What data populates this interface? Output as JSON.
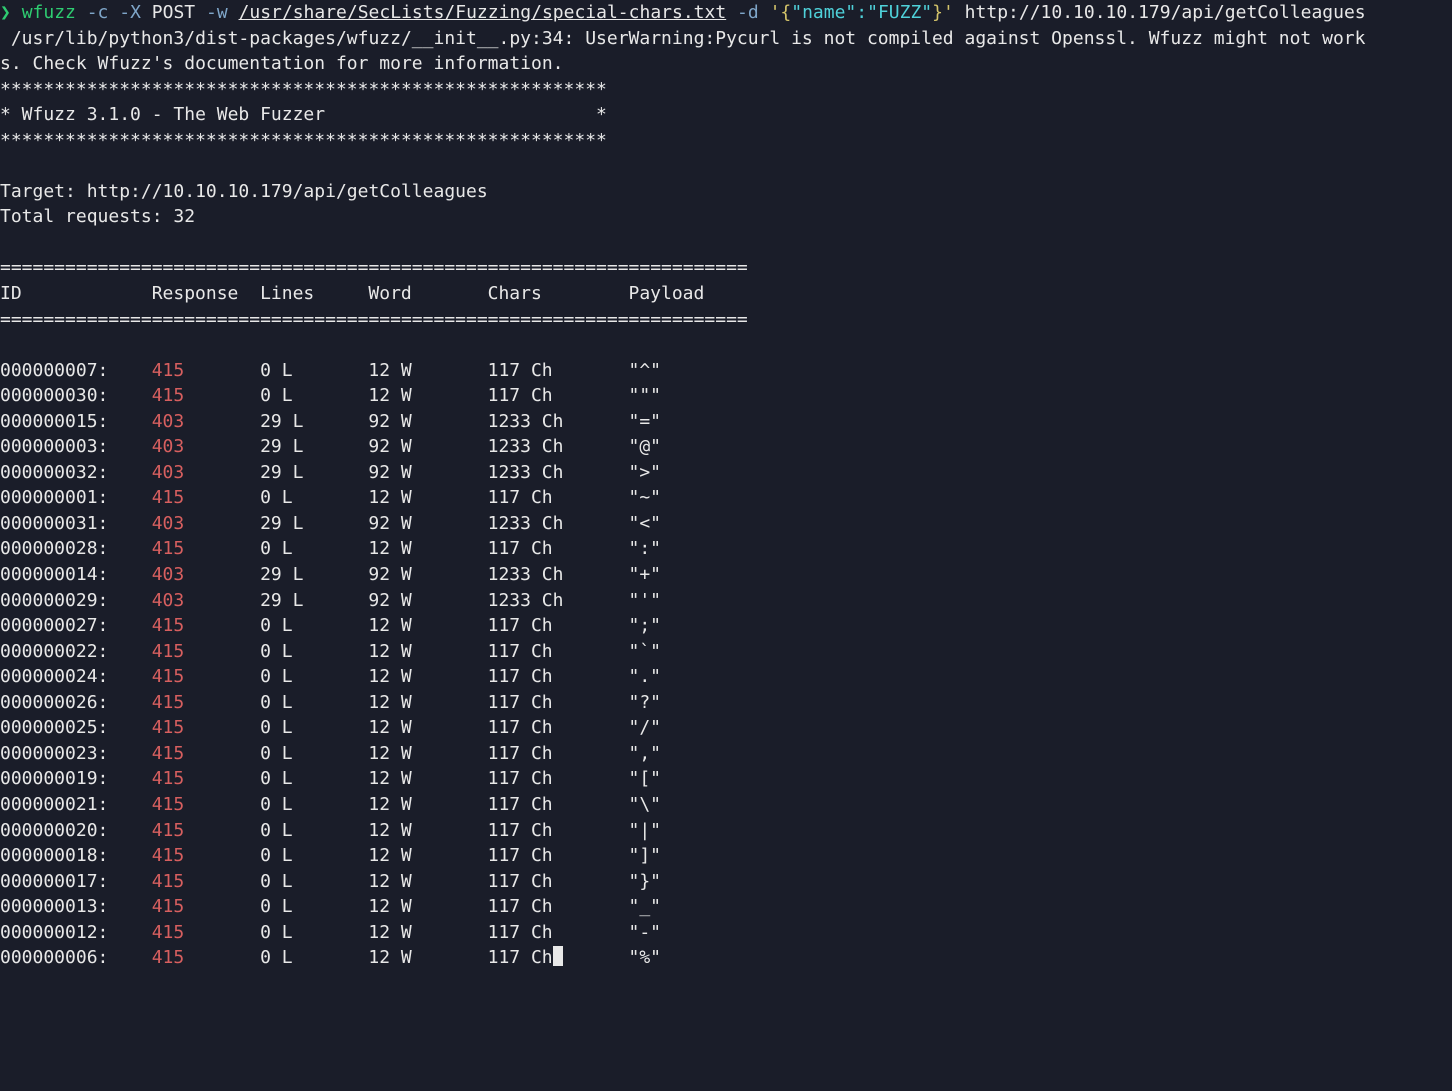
{
  "prompt": {
    "symbol": "❯",
    "command": "wfuzz",
    "flag_c": "-c",
    "flag_X": "-X",
    "method": "POST",
    "flag_w": "-w",
    "wordlist": "/usr/share/SecLists/Fuzzing/special-chars.txt",
    "flag_d": "-d",
    "json_open": "'{",
    "json_name_key": "\"name\"",
    "json_colon": ":",
    "json_fuzz": "\"FUZZ\"",
    "json_close": "}'",
    "url": " http://10.10.10.179/api/getColleagues"
  },
  "warning": " /usr/lib/python3/dist-packages/wfuzz/__init__.py:34: UserWarning:Pycurl is not compiled against Openssl. Wfuzz might not work\ns. Check Wfuzz's documentation for more information.",
  "stars1": "********************************************************",
  "banner_line": "* Wfuzz 3.1.0 - The Web Fuzzer                         *",
  "stars2": "********************************************************",
  "target_line": "Target: http://10.10.10.179/api/getColleagues",
  "total_line": "Total requests: 32",
  "sep": "=====================================================================",
  "headers": {
    "id": "ID",
    "response": "Response",
    "lines": "Lines",
    "word": "Word",
    "chars": "Chars",
    "payload": "Payload"
  },
  "rows": [
    {
      "id": "000000007:",
      "resp": "415",
      "lines": "0 L",
      "word": "12 W",
      "chars": "117 Ch",
      "payload": "\"^\""
    },
    {
      "id": "000000030:",
      "resp": "415",
      "lines": "0 L",
      "word": "12 W",
      "chars": "117 Ch",
      "payload": "\"\"\""
    },
    {
      "id": "000000015:",
      "resp": "403",
      "lines": "29 L",
      "word": "92 W",
      "chars": "1233 Ch",
      "payload": "\"=\""
    },
    {
      "id": "000000003:",
      "resp": "403",
      "lines": "29 L",
      "word": "92 W",
      "chars": "1233 Ch",
      "payload": "\"@\""
    },
    {
      "id": "000000032:",
      "resp": "403",
      "lines": "29 L",
      "word": "92 W",
      "chars": "1233 Ch",
      "payload": "\">\""
    },
    {
      "id": "000000001:",
      "resp": "415",
      "lines": "0 L",
      "word": "12 W",
      "chars": "117 Ch",
      "payload": "\"~\""
    },
    {
      "id": "000000031:",
      "resp": "403",
      "lines": "29 L",
      "word": "92 W",
      "chars": "1233 Ch",
      "payload": "\"<\""
    },
    {
      "id": "000000028:",
      "resp": "415",
      "lines": "0 L",
      "word": "12 W",
      "chars": "117 Ch",
      "payload": "\":\""
    },
    {
      "id": "000000014:",
      "resp": "403",
      "lines": "29 L",
      "word": "92 W",
      "chars": "1233 Ch",
      "payload": "\"+\""
    },
    {
      "id": "000000029:",
      "resp": "403",
      "lines": "29 L",
      "word": "92 W",
      "chars": "1233 Ch",
      "payload": "\"'\""
    },
    {
      "id": "000000027:",
      "resp": "415",
      "lines": "0 L",
      "word": "12 W",
      "chars": "117 Ch",
      "payload": "\";\""
    },
    {
      "id": "000000022:",
      "resp": "415",
      "lines": "0 L",
      "word": "12 W",
      "chars": "117 Ch",
      "payload": "\"`\""
    },
    {
      "id": "000000024:",
      "resp": "415",
      "lines": "0 L",
      "word": "12 W",
      "chars": "117 Ch",
      "payload": "\".\""
    },
    {
      "id": "000000026:",
      "resp": "415",
      "lines": "0 L",
      "word": "12 W",
      "chars": "117 Ch",
      "payload": "\"?\""
    },
    {
      "id": "000000025:",
      "resp": "415",
      "lines": "0 L",
      "word": "12 W",
      "chars": "117 Ch",
      "payload": "\"/\""
    },
    {
      "id": "000000023:",
      "resp": "415",
      "lines": "0 L",
      "word": "12 W",
      "chars": "117 Ch",
      "payload": "\",\""
    },
    {
      "id": "000000019:",
      "resp": "415",
      "lines": "0 L",
      "word": "12 W",
      "chars": "117 Ch",
      "payload": "\"[\""
    },
    {
      "id": "000000021:",
      "resp": "415",
      "lines": "0 L",
      "word": "12 W",
      "chars": "117 Ch",
      "payload": "\"\\\""
    },
    {
      "id": "000000020:",
      "resp": "415",
      "lines": "0 L",
      "word": "12 W",
      "chars": "117 Ch",
      "payload": "\"|\""
    },
    {
      "id": "000000018:",
      "resp": "415",
      "lines": "0 L",
      "word": "12 W",
      "chars": "117 Ch",
      "payload": "\"]\""
    },
    {
      "id": "000000017:",
      "resp": "415",
      "lines": "0 L",
      "word": "12 W",
      "chars": "117 Ch",
      "payload": "\"}\""
    },
    {
      "id": "000000013:",
      "resp": "415",
      "lines": "0 L",
      "word": "12 W",
      "chars": "117 Ch",
      "payload": "\"_\""
    },
    {
      "id": "000000012:",
      "resp": "415",
      "lines": "0 L",
      "word": "12 W",
      "chars": "117 Ch",
      "payload": "\"-\""
    },
    {
      "id": "000000006:",
      "resp": "415",
      "lines": "0 L",
      "word": "12 W",
      "chars": "117 Ch",
      "payload": "\"%\""
    }
  ]
}
